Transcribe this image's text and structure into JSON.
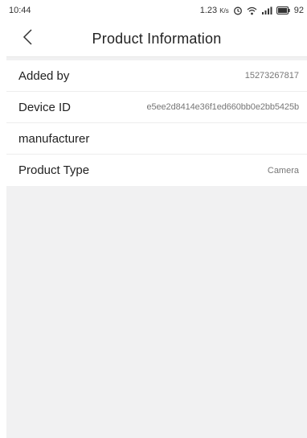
{
  "status_bar": {
    "time": "10:44",
    "network_speed": "1.23",
    "network_unit": "K/s",
    "battery": "92",
    "icons": [
      "alarm-icon",
      "wifi-icon",
      "signal-icon",
      "battery-icon"
    ]
  },
  "header": {
    "title": "Product Information",
    "back_icon": "chevron-left-icon"
  },
  "info": {
    "added_by_label": "Added by",
    "added_by_value": "15273267817",
    "device_id_label": "Device ID",
    "device_id_value": "e5ee2d8414e36f1ed660bb0e2bb5425b",
    "manufacturer_label": "manufacturer",
    "manufacturer_value": "",
    "product_type_label": "Product Type",
    "product_type_value": "Camera"
  },
  "colors": {
    "background": "#f1f1f2",
    "surface": "#ffffff",
    "text_primary": "#222222",
    "text_secondary": "#777777",
    "divider": "#ededed"
  }
}
